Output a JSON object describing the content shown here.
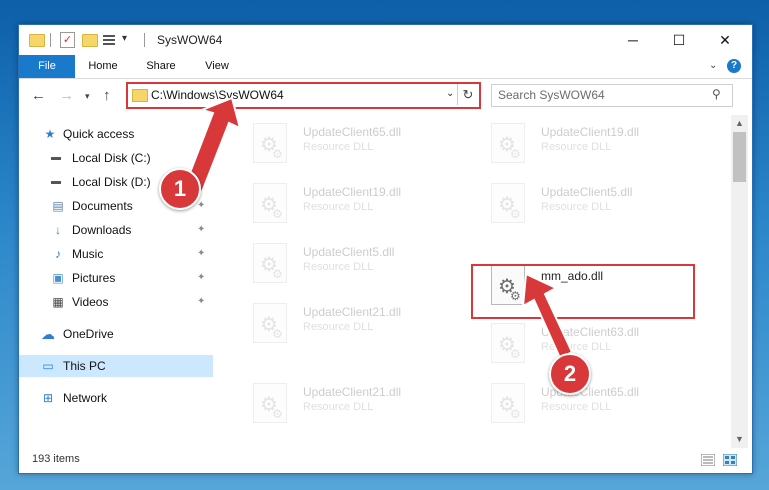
{
  "window": {
    "title": "SysWOW64",
    "controls": {
      "minimize": "─",
      "maximize": "☐",
      "close": "✕"
    }
  },
  "ribbon": {
    "tabs": [
      "File",
      "Home",
      "Share",
      "View"
    ]
  },
  "address": {
    "path": "C:\\Windows\\SysWOW64",
    "search_placeholder": "Search SysWOW64"
  },
  "sidebar": {
    "items": [
      {
        "label": "Quick access",
        "icon": "star-icon"
      },
      {
        "label": "Local Disk (C:)",
        "icon": "drive-icon"
      },
      {
        "label": "Local Disk (D:)",
        "icon": "drive-icon"
      },
      {
        "label": "Documents",
        "icon": "document-icon"
      },
      {
        "label": "Downloads",
        "icon": "download-icon"
      },
      {
        "label": "Music",
        "icon": "music-icon"
      },
      {
        "label": "Pictures",
        "icon": "pictures-icon"
      },
      {
        "label": "Videos",
        "icon": "video-icon"
      },
      {
        "label": "OneDrive",
        "icon": "cloud-icon"
      },
      {
        "label": "This PC",
        "icon": "computer-icon"
      },
      {
        "label": "Network",
        "icon": "network-icon"
      }
    ]
  },
  "files": [
    {
      "name": "UpdateClient65.dll",
      "type": "Resource DLL"
    },
    {
      "name": "UpdateClient19.dll",
      "type": "Resource DLL"
    },
    {
      "name": "UpdateClient19.dll",
      "type": "Resource DLL"
    },
    {
      "name": "UpdateClient5.dll",
      "type": "Resource DLL"
    },
    {
      "name": "UpdateClient5.dll",
      "type": "Resource DLL"
    },
    {
      "name": "mm_ado.dll",
      "type": ""
    },
    {
      "name": "UpdateClient21.dll",
      "type": "Resource DLL"
    },
    {
      "name": "UpdateClient63.dll",
      "type": "Resource DLL"
    },
    {
      "name": "UpdateClient21.dll",
      "type": "Resource DLL"
    },
    {
      "name": "UpdateClient65.dll",
      "type": "Resource DLL"
    }
  ],
  "status": {
    "items": "193 items"
  },
  "annotations": {
    "step1": "1",
    "step2": "2"
  },
  "colors": {
    "accent": "#1979ca",
    "annotation": "#d9383a",
    "selection": "#cce8ff"
  }
}
